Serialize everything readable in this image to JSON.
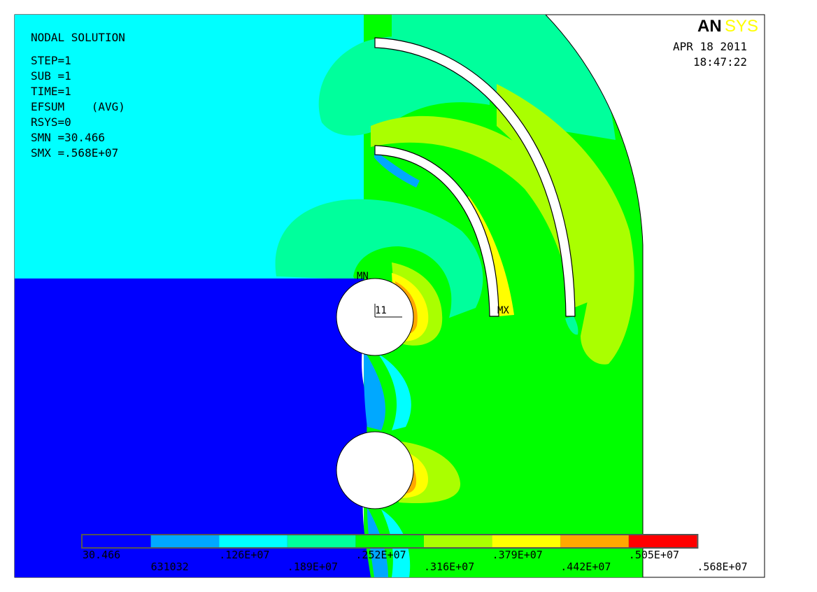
{
  "header": {
    "title": "NODAL SOLUTION",
    "lines": [
      "STEP=1",
      "SUB =1",
      "TIME=1",
      "EFSUM    (AVG)",
      "RSYS=0",
      "SMN =30.466",
      "SMX =.568E+07"
    ]
  },
  "timestamp": {
    "date": "APR 18 2011",
    "time": "18:47:22"
  },
  "logo": {
    "part1": "AN",
    "part2": "SYS",
    "color1": "#000000",
    "color2": "#ffff00"
  },
  "markers": {
    "min": "MN",
    "max": "MX",
    "node": "11"
  },
  "colors": {
    "c0": "#0000ff",
    "c1": "#00a8ff",
    "c2": "#00ffff",
    "c3": "#00ff9c",
    "c4": "#00ff00",
    "c5": "#aaff00",
    "c6": "#ffff00",
    "c7": "#ffa800",
    "c8": "#ff0000"
  },
  "legend": {
    "labels": [
      "30.466",
      "631032",
      ".126E+07",
      ".189E+07",
      ".252E+07",
      ".316E+07",
      ".379E+07",
      ".442E+07",
      ".505E+07",
      ".568E+07"
    ],
    "colors": [
      "#0000ff",
      "#00a8ff",
      "#00ffff",
      "#00ff9c",
      "#00ff00",
      "#aaff00",
      "#ffff00",
      "#ffa800",
      "#ff0000"
    ]
  },
  "chart_data": {
    "type": "heatmap",
    "title": "NODAL SOLUTION",
    "quantity": "EFSUM (AVG)",
    "step": 1,
    "substep": 1,
    "time": 1,
    "rsys": 0,
    "min": 30.466,
    "max": 5680000,
    "contour_levels": [
      30.466,
      631032,
      1260000,
      1890000,
      2520000,
      3160000,
      3790000,
      4420000,
      5050000,
      5680000
    ]
  }
}
